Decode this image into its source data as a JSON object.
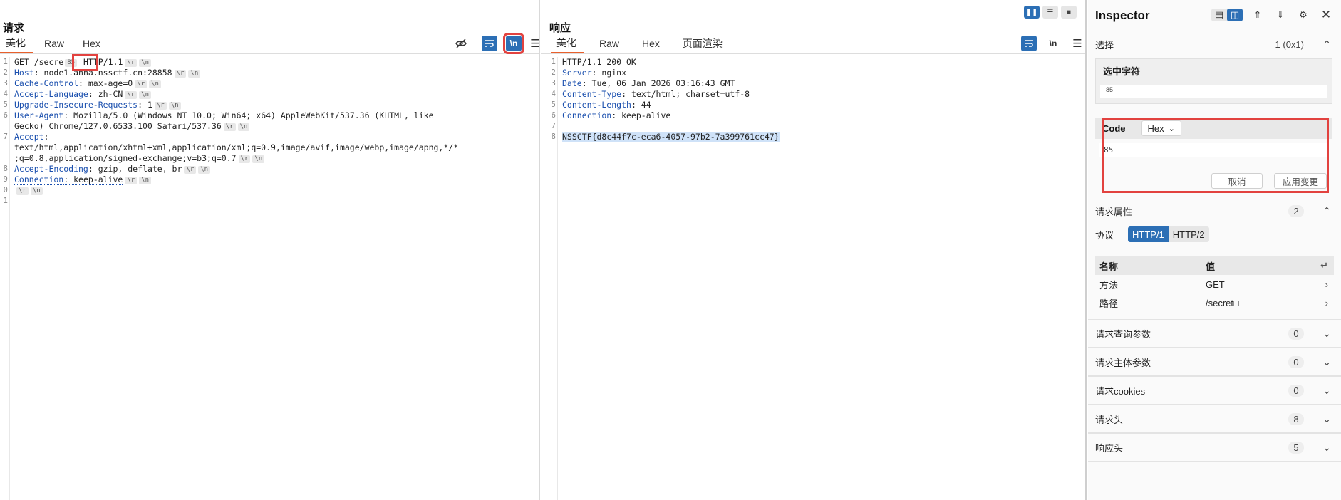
{
  "request": {
    "title": "请求",
    "tabs": [
      "美化",
      "Raw",
      "Hex"
    ],
    "line_numbers": [
      "1",
      "2",
      "3",
      "4",
      "5",
      "6",
      "",
      "7",
      "",
      "",
      "8",
      "9",
      "0",
      "1"
    ],
    "lines": [
      {
        "key": "",
        "pre": "GET /secre",
        "sel": "85",
        "post": " HTTP/1.1"
      },
      {
        "key": "Host",
        "val": ": node1.anna.nssctf.cn:28858"
      },
      {
        "key": "Cache-Control",
        "val": ": max-age=0"
      },
      {
        "key": "Accept-Language",
        "val": ": zh-CN"
      },
      {
        "key": "Upgrade-Insecure-Requests",
        "val": ": 1"
      },
      {
        "key": "User-Agent",
        "val": ": Mozilla/5.0 (Windows NT 10.0; Win64; x64) AppleWebKit/537.36 (KHTML, like"
      },
      {
        "key": "",
        "val": "Gecko) Chrome/127.0.6533.100 Safari/537.36"
      },
      {
        "key": "Accept",
        "val": ":"
      },
      {
        "key": "",
        "val": "text/html,application/xhtml+xml,application/xml;q=0.9,image/avif,image/webp,image/apng,*/*"
      },
      {
        "key": "",
        "val": ";q=0.8,application/signed-exchange;v=b3;q=0.7"
      },
      {
        "key": "Accept-Encoding",
        "val": ": gzip, deflate, br"
      },
      {
        "key": "Connection",
        "val": ": keep-alive"
      },
      {
        "key": "",
        "val": ""
      }
    ],
    "escapes": "\\r \\n"
  },
  "response": {
    "title": "响应",
    "tabs": [
      "美化",
      "Raw",
      "Hex",
      "页面渲染"
    ],
    "line_numbers": [
      "1",
      "2",
      "3",
      "4",
      "5",
      "6",
      "7",
      "8"
    ],
    "lines": [
      {
        "key": "",
        "val": "HTTP/1.1 200 OK"
      },
      {
        "key": "Server",
        "val": ": nginx"
      },
      {
        "key": "Date",
        "val": ": Tue, 06 Jan 2026 03:16:43 GMT"
      },
      {
        "key": "Content-Type",
        "val": ": text/html; charset=utf-8"
      },
      {
        "key": "Content-Length",
        "val": ": 44"
      },
      {
        "key": "Connection",
        "val": ": keep-alive"
      },
      {
        "key": "",
        "val": ""
      },
      {
        "key": "",
        "val": "NSSCTF{d8c44f7c-eca6-4057-97b2-7a399761cc47}"
      }
    ]
  },
  "inspector": {
    "title": "Inspector",
    "selection": {
      "label": "选择",
      "count": "1 (0x1)"
    },
    "selected_chars": {
      "label": "选中字符",
      "value": "85"
    },
    "code": {
      "label": "Code",
      "format": "Hex",
      "value": "85",
      "cancel": "取消",
      "apply": "应用变更"
    },
    "request_attrs": {
      "label": "请求属性",
      "count": "2"
    },
    "protocol": {
      "label": "协议",
      "options": [
        "HTTP/1",
        "HTTP/2"
      ]
    },
    "table": {
      "headers": [
        "名称",
        "值"
      ],
      "rows": [
        [
          "方法",
          "GET"
        ],
        [
          "路径",
          "/secret□"
        ]
      ]
    },
    "sections": [
      {
        "label": "请求查询参数",
        "count": "0"
      },
      {
        "label": "请求主体参数",
        "count": "0"
      },
      {
        "label": "请求cookies",
        "count": "0"
      },
      {
        "label": "请求头",
        "count": "8"
      },
      {
        "label": "响应头",
        "count": "5"
      }
    ]
  }
}
